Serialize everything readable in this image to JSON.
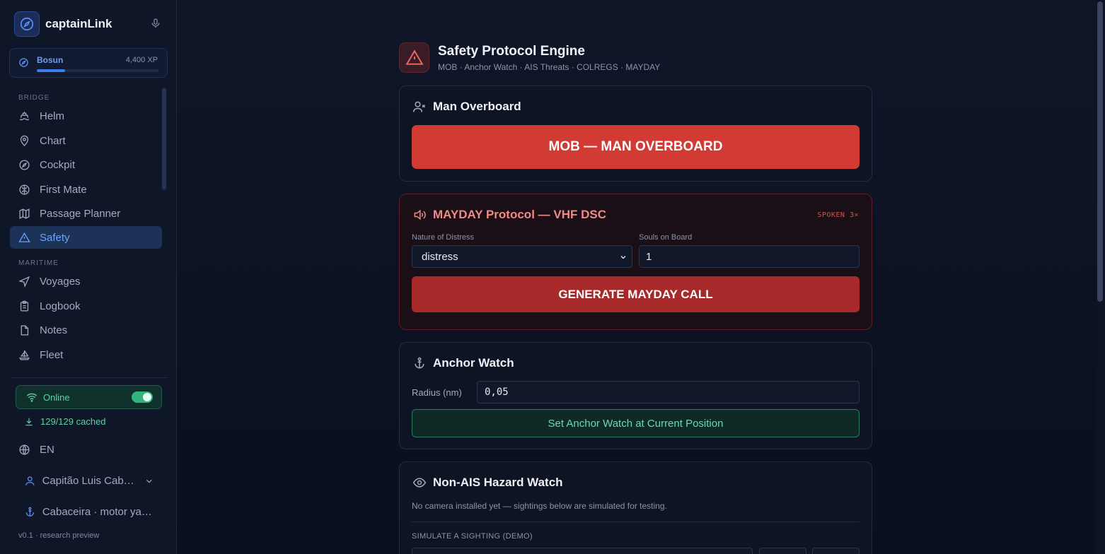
{
  "app": {
    "name": "captainLink"
  },
  "rank": {
    "name": "Bosun",
    "xp": "4,400 XP",
    "progress": 0.23
  },
  "nav": {
    "bridge_label": "BRIDGE",
    "bridge": [
      {
        "label": "Helm",
        "icon": "helm-icon"
      },
      {
        "label": "Chart",
        "icon": "map-pin-icon"
      },
      {
        "label": "Cockpit",
        "icon": "compass-icon"
      },
      {
        "label": "First Mate",
        "icon": "brain-icon"
      },
      {
        "label": "Passage Planner",
        "icon": "map-icon"
      },
      {
        "label": "Safety",
        "icon": "warning-icon",
        "active": true
      }
    ],
    "maritime_label": "MARITIME",
    "maritime": [
      {
        "label": "Voyages",
        "icon": "navigation-icon"
      },
      {
        "label": "Logbook",
        "icon": "clipboard-icon"
      },
      {
        "label": "Notes",
        "icon": "file-icon"
      },
      {
        "label": "Fleet",
        "icon": "sailboat-icon"
      }
    ]
  },
  "status": {
    "online": "Online",
    "cached": "129/129 cached",
    "language": "EN"
  },
  "user": {
    "name": "Capitão Luis Cabaceira",
    "vessel": "Cabaceira · motor yacht"
  },
  "version": "v0.1 · research preview",
  "page": {
    "title": "Safety Protocol Engine",
    "subtitle": "MOB · Anchor Watch · AIS Threats · COLREGS · MAYDAY"
  },
  "mob": {
    "title": "Man Overboard",
    "button": "MOB — MAN OVERBOARD"
  },
  "mayday": {
    "title": "MAYDAY Protocol — VHF DSC",
    "badge": "SPOKEN 3×",
    "nature_label": "Nature of Distress",
    "nature_value": "distress",
    "souls_label": "Souls on Board",
    "souls_value": "1",
    "button": "GENERATE MAYDAY CALL"
  },
  "anchor": {
    "title": "Anchor Watch",
    "radius_label": "Radius (nm)",
    "radius_value": "0,05",
    "button": "Set Anchor Watch at Current Position"
  },
  "hazard": {
    "title": "Non-AIS Hazard Watch",
    "note": "No camera installed yet — sightings below are simulated for testing.",
    "simulate_label": "SIMULATE A SIGHTING (DEMO)"
  },
  "colors": {
    "accent": "#3b7cf5",
    "danger": "#d23a34",
    "success": "#35b37e"
  }
}
